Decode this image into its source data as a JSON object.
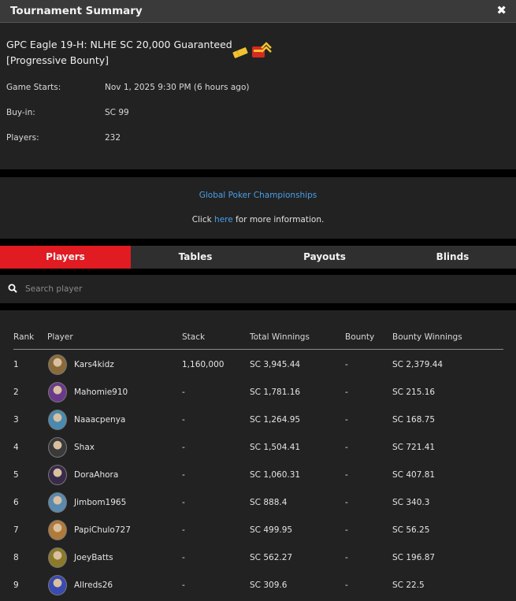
{
  "window": {
    "title": "Tournament Summary",
    "close_glyph": "✖"
  },
  "tournament": {
    "name": "GPC Eagle 19-H: NLHE SC 20,000 Guaranteed [Progressive Bounty]",
    "icons": [
      "ticket-icon",
      "progressive-bounty-icon"
    ],
    "details": [
      {
        "label": "Game Starts:",
        "value": "Nov 1, 2025 9:30 PM (6 hours ago)"
      },
      {
        "label": "Buy-in:",
        "value": "SC 99"
      },
      {
        "label": "Players:",
        "value": "232"
      }
    ]
  },
  "promo": {
    "series_link": "Global Poker Championships",
    "more_prefix": "Click ",
    "more_link": "here",
    "more_suffix": " for more information."
  },
  "tabs": [
    {
      "label": "Players",
      "active": true
    },
    {
      "label": "Tables",
      "active": false
    },
    {
      "label": "Payouts",
      "active": false
    },
    {
      "label": "Blinds",
      "active": false
    }
  ],
  "search": {
    "placeholder": "Search player",
    "value": ""
  },
  "table": {
    "headers": [
      "Rank",
      "Player",
      "Stack",
      "Total Winnings",
      "Bounty",
      "Bounty Winnings"
    ],
    "rows": [
      {
        "rank": "1",
        "player": "Kars4kidz",
        "stack": "1,160,000",
        "total_winnings": "SC 3,945.44",
        "bounty": "-",
        "bounty_winnings": "SC 2,379.44",
        "avatar_color": "#8a6a3a"
      },
      {
        "rank": "2",
        "player": "Mahomie910",
        "stack": "-",
        "total_winnings": "SC 1,781.16",
        "bounty": "-",
        "bounty_winnings": "SC 215.16",
        "avatar_color": "#6a3a8a"
      },
      {
        "rank": "3",
        "player": "Naaacpenya",
        "stack": "-",
        "total_winnings": "SC 1,264.95",
        "bounty": "-",
        "bounty_winnings": "SC 168.75",
        "avatar_color": "#4a8ab0"
      },
      {
        "rank": "4",
        "player": "Shax",
        "stack": "-",
        "total_winnings": "SC 1,504.41",
        "bounty": "-",
        "bounty_winnings": "SC 721.41",
        "avatar_color": "#3a3a3a"
      },
      {
        "rank": "5",
        "player": "DoraAhora",
        "stack": "-",
        "total_winnings": "SC 1,060.31",
        "bounty": "-",
        "bounty_winnings": "SC 407.81",
        "avatar_color": "#3a2a4a"
      },
      {
        "rank": "6",
        "player": "Jimbom1965",
        "stack": "-",
        "total_winnings": "SC 888.4",
        "bounty": "-",
        "bounty_winnings": "SC 340.3",
        "avatar_color": "#5a8ab0"
      },
      {
        "rank": "7",
        "player": "PapiChulo727",
        "stack": "-",
        "total_winnings": "SC 499.95",
        "bounty": "-",
        "bounty_winnings": "SC 56.25",
        "avatar_color": "#b07a3a"
      },
      {
        "rank": "8",
        "player": "JoeyBatts",
        "stack": "-",
        "total_winnings": "SC 562.27",
        "bounty": "-",
        "bounty_winnings": "SC 196.87",
        "avatar_color": "#8a7a2a"
      },
      {
        "rank": "9",
        "player": "Allreds26",
        "stack": "-",
        "total_winnings": "SC 309.6",
        "bounty": "-",
        "bounty_winnings": "SC 22.5",
        "avatar_color": "#3a4ab0"
      }
    ]
  },
  "colors": {
    "accent": "#e01b22",
    "link": "#4a9ee8",
    "panel": "#222222",
    "header": "#3a3a3a"
  }
}
